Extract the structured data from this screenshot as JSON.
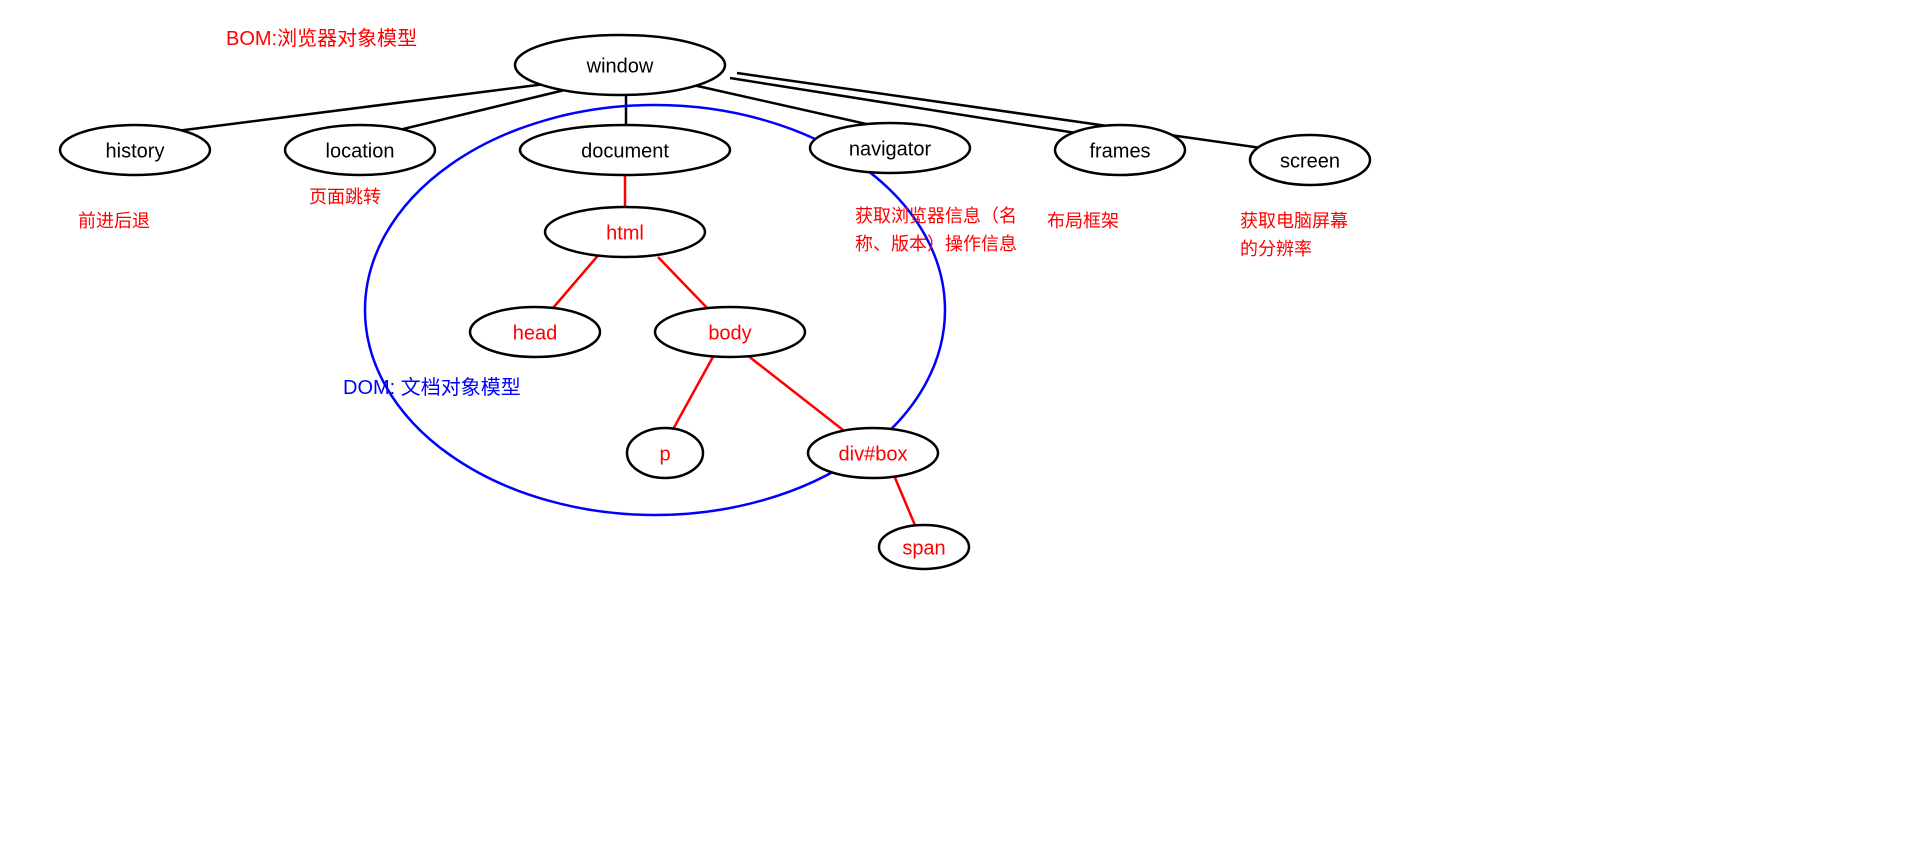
{
  "title_bom": "BOM:浏览器对象模型",
  "title_dom": "DOM: 文档对象模型",
  "nodes": {
    "window": "window",
    "history": "history",
    "location": "location",
    "document": "document",
    "navigator": "navigator",
    "frames": "frames",
    "screen": "screen",
    "html": "html",
    "head": "head",
    "body": "body",
    "p": "p",
    "divbox": "div#box",
    "span": "span"
  },
  "annotations": {
    "history": "前进后退",
    "location": "页面跳转",
    "navigator": "获取浏览器信息（名称、版本）操作信息",
    "frames": "布局框架",
    "screen": "获取电脑屏幕的分辨率"
  }
}
